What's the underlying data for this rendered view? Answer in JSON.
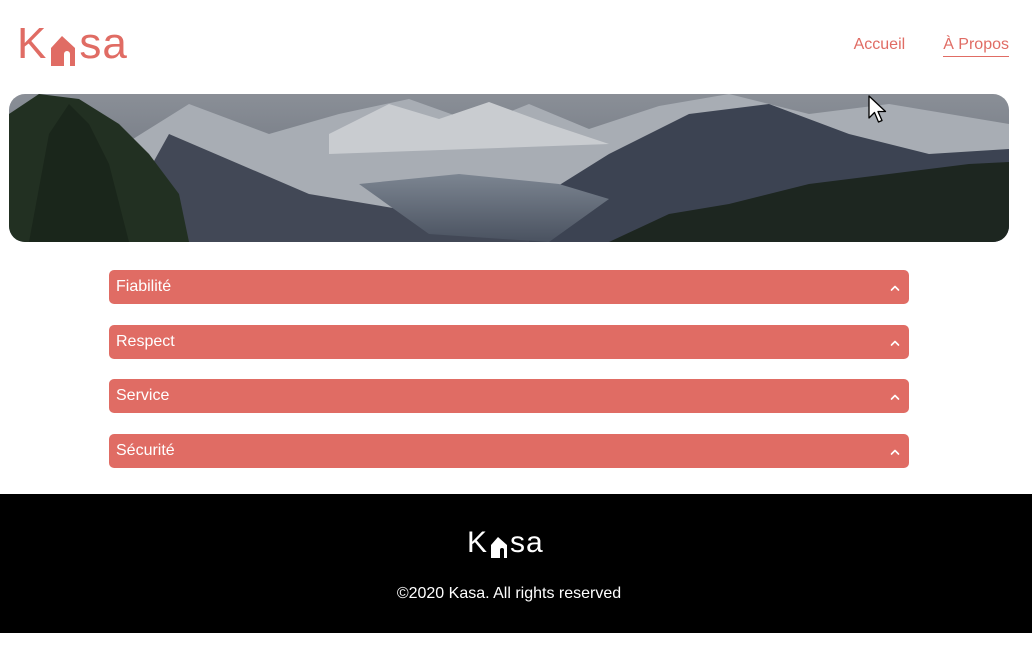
{
  "header": {
    "logo_prefix": "K",
    "logo_suffix": "sa",
    "nav": [
      {
        "label": "Accueil"
      },
      {
        "label": "À Propos"
      }
    ]
  },
  "collapses": [
    {
      "label": "Fiabilité"
    },
    {
      "label": "Respect"
    },
    {
      "label": "Service"
    },
    {
      "label": "Sécurité"
    }
  ],
  "footer": {
    "logo_prefix": "K",
    "logo_suffix": "sa",
    "copyright": "©2020 Kasa. All rights reserved"
  },
  "colors": {
    "accent": "#e06c64",
    "footer_bg": "#000000"
  }
}
